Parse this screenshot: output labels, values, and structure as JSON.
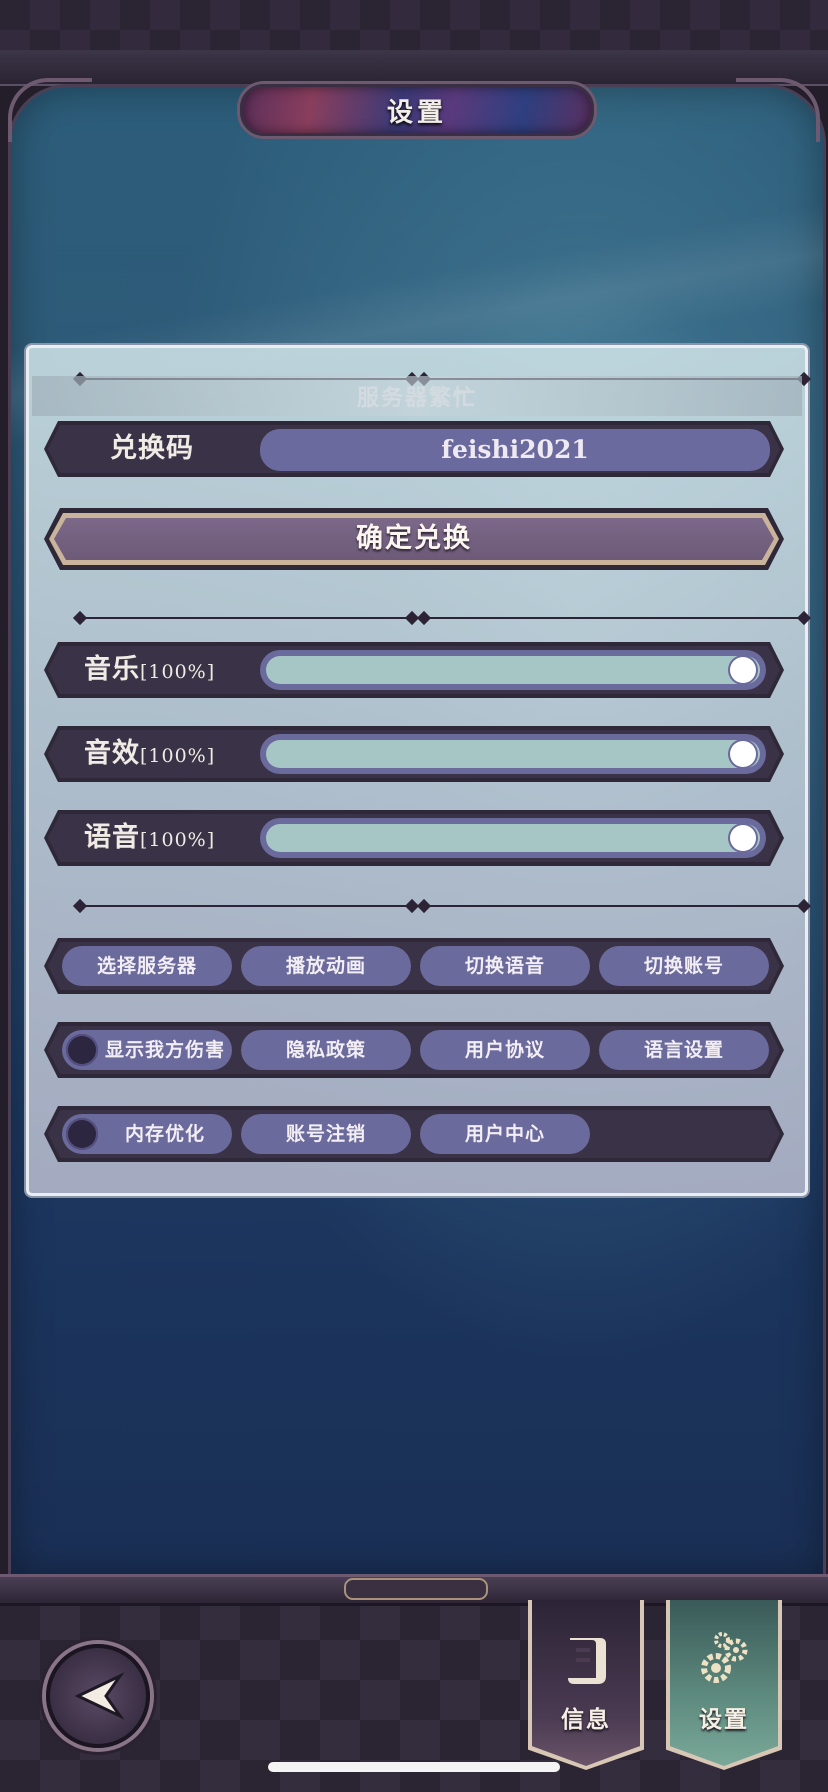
{
  "header": {
    "title": "设置"
  },
  "panel": {
    "status_text": "服务器繁忙",
    "redeem": {
      "label": "兑换码",
      "code_value": "feishi2021",
      "confirm_label": "确定兑换"
    },
    "volume": [
      {
        "label": "音乐",
        "value_text": "[100%]",
        "level": 1.0
      },
      {
        "label": "音效",
        "value_text": "[100%]",
        "level": 1.0
      },
      {
        "label": "语音",
        "value_text": "[100%]",
        "level": 1.0
      }
    ],
    "button_rows": [
      {
        "buttons": [
          {
            "label": "选择服务器"
          },
          {
            "label": "播放动画"
          },
          {
            "label": "切换语音"
          },
          {
            "label": "切换账号"
          }
        ]
      },
      {
        "buttons": [
          {
            "label": "显示我方伤害",
            "toggle": false
          },
          {
            "label": "隐私政策"
          },
          {
            "label": "用户协议"
          },
          {
            "label": "语言设置"
          }
        ]
      },
      {
        "buttons": [
          {
            "label": "内存优化",
            "toggle": false
          },
          {
            "label": "账号注销"
          },
          {
            "label": "用户中心"
          }
        ]
      }
    ]
  },
  "bottom_nav": {
    "back_icon": "back-arrow-icon",
    "tabs": [
      {
        "label": "信息",
        "icon": "scroll-icon",
        "active": false
      },
      {
        "label": "设置",
        "icon": "gears-icon",
        "active": true
      }
    ]
  },
  "colors": {
    "pill": "#6a6a9c",
    "slider_fill": "#a6c5c5",
    "row_dark": "#3a3246",
    "active_tab": "#5f8c80"
  }
}
